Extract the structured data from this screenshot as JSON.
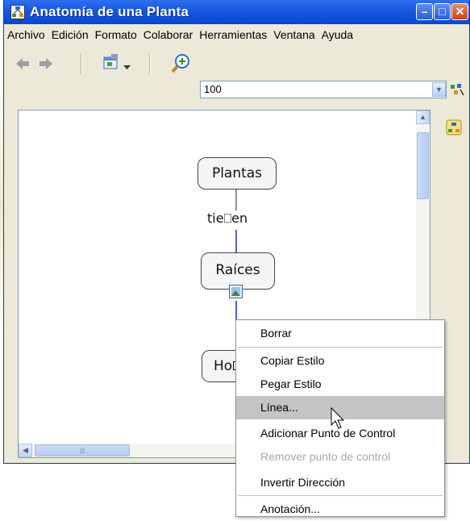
{
  "window": {
    "title": "Anatomía de una Planta",
    "minimize_label": "–",
    "maximize_label": "□",
    "close_label": "✕"
  },
  "menubar": {
    "items": [
      "Archivo",
      "Edición",
      "Formato",
      "Colaborar",
      "Herramientas",
      "Ventana",
      "Ayuda"
    ]
  },
  "toolbar": {
    "zoom_value": "100"
  },
  "concept_map": {
    "nodes": [
      "Plantas",
      "Raíces",
      "Ho"
    ],
    "link_phrase": "tie⎕en"
  },
  "context_menu": {
    "items": [
      {
        "label": "Borrar",
        "enabled": true
      },
      {
        "label": "Copiar Estilo",
        "enabled": true
      },
      {
        "label": "Pegar Estilo",
        "enabled": true
      },
      {
        "label": "Línea...",
        "enabled": true,
        "highlighted": true
      },
      {
        "label": "Adicionar Punto de Control",
        "enabled": true
      },
      {
        "label": "Remover punto de control",
        "enabled": false
      },
      {
        "label": "Invertir Dirección",
        "enabled": true
      },
      {
        "label": "Anotación...",
        "enabled": true
      }
    ]
  },
  "colors": {
    "titlebar": "#0a46d2",
    "link_line": "#1a2aa8",
    "menu_highlight": "#c4c4c4"
  }
}
